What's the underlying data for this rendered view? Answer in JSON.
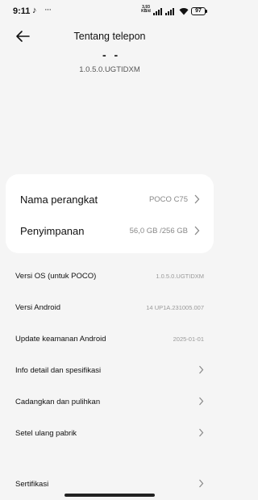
{
  "status_bar": {
    "time": "9:11",
    "network_speed_value": "3,93",
    "network_speed_unit": "KB/d",
    "battery": "97"
  },
  "header": {
    "title": "Tentang telepon",
    "logo_fragment": "- -",
    "os_version": "1.0.5.0.UGTIDXM"
  },
  "device_card": [
    {
      "label": "Nama perangkat",
      "value": "POCO C75"
    },
    {
      "label": "Penyimpanan",
      "value": "56,0 GB /256 GB"
    }
  ],
  "info_list": [
    {
      "label": "Versi OS (untuk POCO)",
      "value": "1.0.5.0.UGTIDXM"
    },
    {
      "label": "Versi Android",
      "value": "14 UP1A.231005.007"
    },
    {
      "label": "Update keamanan Android",
      "value": "2025-01-01"
    },
    {
      "label": "Info detail dan spesifikasi"
    },
    {
      "label": "Cadangkan dan pulihkan"
    },
    {
      "label": "Setel ulang pabrik"
    },
    {
      "label": "Sertifikasi"
    }
  ],
  "icons": {
    "back": "arrow-left-icon",
    "chevron": "chevron-right-icon",
    "wifi": "wifi-icon",
    "tiktok": "tiktok-icon"
  },
  "colors": {
    "background": "#f5f5f5",
    "card": "#ffffff",
    "secondary_text": "#888888"
  }
}
